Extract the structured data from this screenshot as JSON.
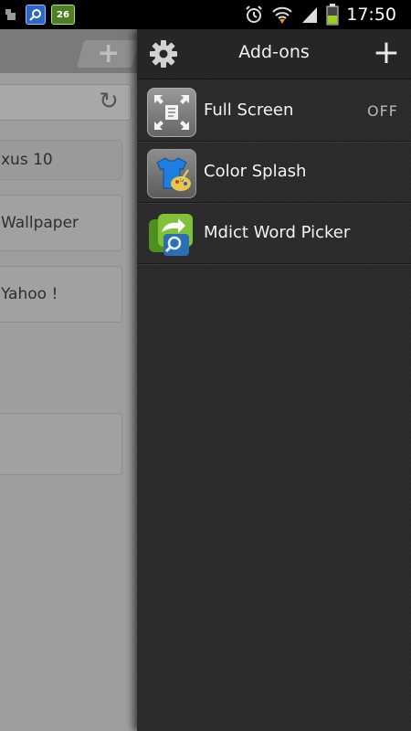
{
  "status_bar": {
    "time": "17:50",
    "calendar_badge": "26"
  },
  "browser_panel": {
    "items": [
      "xus 10",
      "Wallpaper",
      "Yahoo !",
      ""
    ]
  },
  "drawer": {
    "title": "Add-ons",
    "addons": [
      {
        "name": "Full Screen",
        "status": "OFF",
        "icon": "fullscreen-icon"
      },
      {
        "name": "Color Splash",
        "status": "",
        "icon": "color-splash-icon"
      },
      {
        "name": "Mdict Word Picker",
        "status": "",
        "icon": "word-picker-icon"
      }
    ]
  }
}
